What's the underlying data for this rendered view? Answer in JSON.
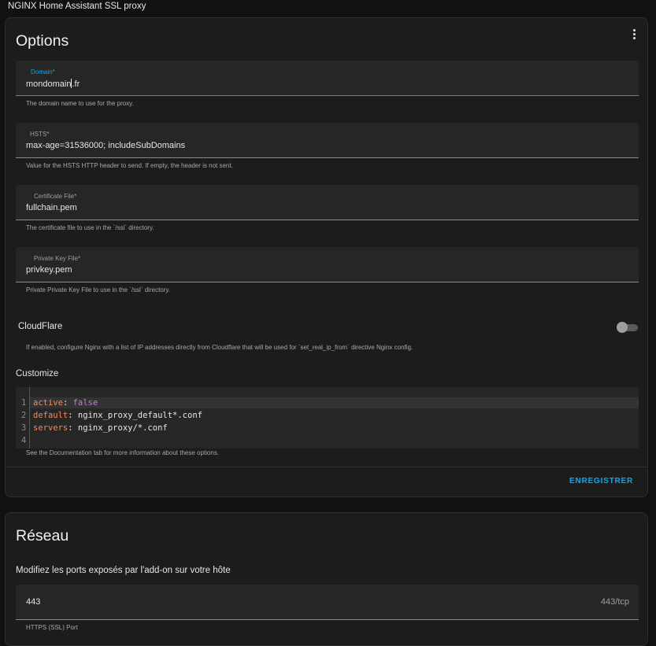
{
  "app": {
    "title": "NGINX Home Assistant SSL proxy"
  },
  "options": {
    "title": "Options",
    "fields": [
      {
        "label": "Domain*",
        "value_prefix": "mondomain",
        "value_suffix": ".fr",
        "helper": "The domain name to use for the proxy."
      },
      {
        "label": "HSTS*",
        "value": "max-age=31536000; includeSubDomains",
        "helper": "Value for the HSTS HTTP header to send. If empty, the header is not sent."
      },
      {
        "label": "Certificate File*",
        "value": "fullchain.pem",
        "helper": "The certificate file to use in the `/ssl` directory."
      },
      {
        "label": "Private Key File*",
        "value": "privkey.pem",
        "helper": "Private Private Key File to use in the `/ssl` directory."
      }
    ],
    "cloudflare": {
      "label": "CloudFlare",
      "enabled": false,
      "helper": "If enabled, configure Nginx with a list of IP addresses directly from Cloudflare that will be used for `set_real_ip_from` directive Nginx config."
    },
    "customize": {
      "label": "Customize",
      "lines": [
        {
          "no": "1",
          "key": "active",
          "value": "false"
        },
        {
          "no": "2",
          "key": "default",
          "value": "nginx_proxy_default*.conf"
        },
        {
          "no": "3",
          "key": "servers",
          "value": "nginx_proxy/*.conf"
        },
        {
          "no": "4",
          "key": "",
          "value": ""
        }
      ],
      "helper": "See the Documentation tab for more information about these options."
    },
    "save_label": "ENREGISTRER"
  },
  "network": {
    "title": "Réseau",
    "description": "Modifiez les ports exposés par l'add-on sur votre hôte",
    "port": {
      "value": "443",
      "suffix": "443/tcp",
      "helper": "HTTPS (SSL) Port"
    }
  },
  "colors": {
    "accent": "#03a9f4",
    "background": "#111111",
    "card": "#1c1c1c",
    "field": "#262626"
  }
}
